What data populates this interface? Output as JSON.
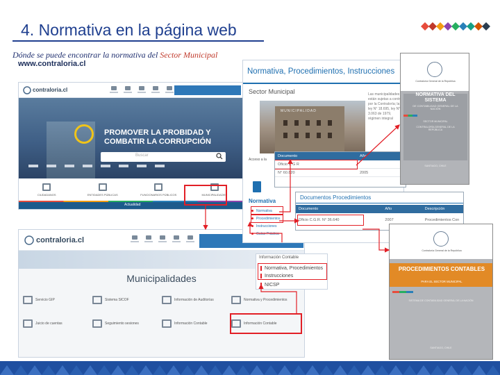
{
  "slide": {
    "title": "4. Normativa en la página web",
    "subtitle_prefix": "Dónde se puede encontrar la normativa del ",
    "subtitle_highlight": "Sector Municipal",
    "url": "www.contraloria.cl"
  },
  "colors": {
    "title": "#1f3f8f",
    "accent_red": "#e21f26",
    "site_blue": "#1e6fb0",
    "orange_cover": "#e28a26"
  },
  "homepage": {
    "logo": "contraloria.cl",
    "hero_text": "PROMOVER LA PROBIDAD Y COMBATIR LA CORRUPCIÓN",
    "search_placeholder": "Buscar",
    "tiles": [
      "CIUDADANOS",
      "ENTIDADES PÚBLICAS",
      "FUNCIONARIOS PÚBLICOS",
      "MUNICIPALIDADES"
    ],
    "footer_link": "Actualidad"
  },
  "municipalidades": {
    "logo": "contraloria.cl",
    "title": "Municipalidades",
    "items": [
      "Servicio GIP",
      "Sistema SICOF",
      "Información de Auditorías",
      "Normativa y Procedimientos",
      "Juicio de cuentas",
      "Seguimiento sesiones",
      "Información Contable",
      "Información Contable"
    ]
  },
  "sector": {
    "header": "Normativa, Procedimientos, Instrucciones",
    "title": "Sector Municipal",
    "side_text": "Las municipalidades están sujetas a control por la Contraloría; la ley N° 18.695, ley N° 3.063 de 1979, régimen integral",
    "municipalidad_sign": "MUNICIPALIDAD",
    "access_label": "Acceso a la",
    "normativa_heading": "Normativa",
    "normativa_items": [
      "Normativa",
      "Procedimientos",
      "Instrucciones",
      "Guías Práctica"
    ]
  },
  "doc_table": {
    "col_doc": "Documento",
    "col_year": "Año",
    "rows": [
      {
        "doc": "Oficio C G R",
        "year": ""
      },
      {
        "doc": "N° 60.820",
        "year": "2005"
      }
    ]
  },
  "procedimientos": {
    "title": "Documentos Procedimientos",
    "col_doc": "Documento",
    "col_year": "Año",
    "col_desc": "Descripción",
    "row": {
      "doc": "Oficio C.G.R. N° 36.640",
      "year": "2007",
      "desc": "Procedimientos Con"
    }
  },
  "contable_menu": {
    "heading": "Información Contable",
    "items": [
      "Normativa, Procedimientos",
      "Instrucciones",
      "NICSP"
    ]
  },
  "cover1": {
    "logo_text": "Contraloría General de la República",
    "title": "NORMATIVA DEL SISTEMA",
    "subtitle": "DE CONTABILIDAD GENERAL DE LA NACIÓN",
    "line1": "SECTOR MUNICIPAL",
    "line2": "CONTRALORÍA GENERAL DE LA REPÚBLICA",
    "footer": "SANTIAGO, CHILE"
  },
  "cover2": {
    "logo_text": "Contraloría General de la República",
    "title": "PROCEDIMIENTOS CONTABLES",
    "subtitle": "PARA EL SECTOR MUNICIPAL",
    "line1": "SISTEMA DE CONTABILIDAD GENERAL DE LA NACIÓN",
    "footer": "SANTIAGO, CHILE"
  }
}
